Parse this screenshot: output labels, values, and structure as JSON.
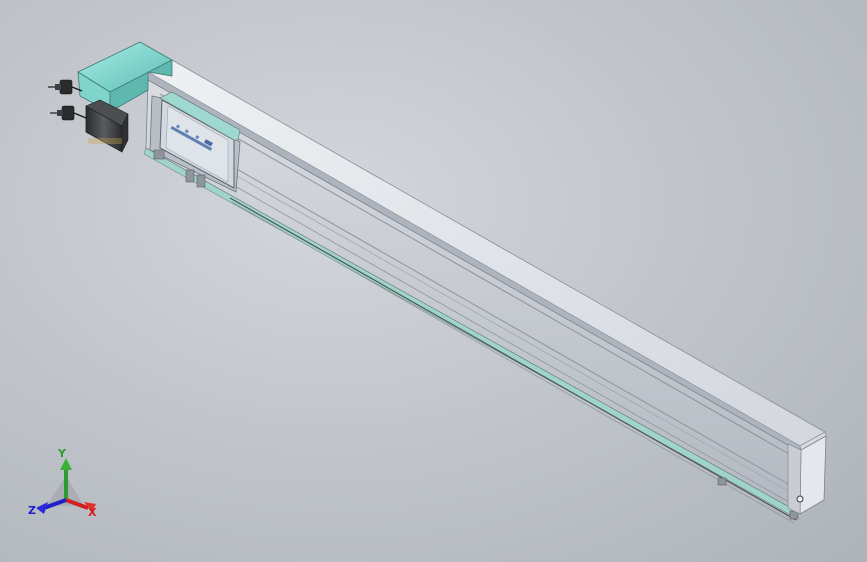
{
  "viewport": {
    "background": "#c2c6cc",
    "model": "linear-actuator-module",
    "colors": {
      "rail_body": "#c7ccd3",
      "rail_top": "#e2e5ea",
      "rail_side": "#b9bec6",
      "teal_accent": "#7fd4cc",
      "motor_body": "#3c3d3f",
      "carriage_plate": "#cfd5dc",
      "logo": "#4b6fa8"
    }
  },
  "triad": {
    "x_label": "X",
    "y_label": "Y",
    "z_label": "Z",
    "x_color": "#d02020",
    "y_color": "#2f9a2f",
    "z_color": "#2020c8"
  }
}
